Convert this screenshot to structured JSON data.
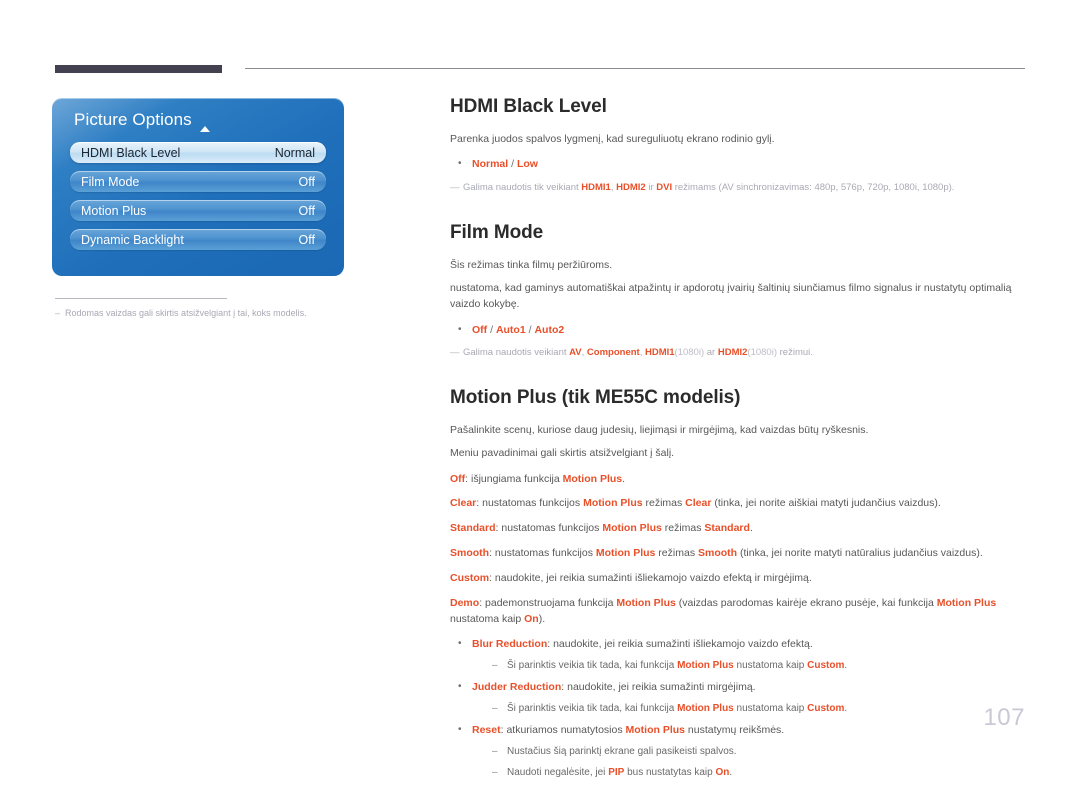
{
  "page_number": "107",
  "osd": {
    "title": "Picture Options",
    "scroll_indicator": "up-arrow",
    "rows": [
      {
        "label": "HDMI Black Level",
        "value": "Normal",
        "selected": true
      },
      {
        "label": "Film Mode",
        "value": "Off",
        "selected": false
      },
      {
        "label": "Motion Plus",
        "value": "Off",
        "selected": false
      },
      {
        "label": "Dynamic Backlight",
        "value": "Off",
        "selected": false
      }
    ],
    "footnote_dash": "‒",
    "footnote": "Rodomas vaizdas gali skirtis atsižvelgiant į tai, koks modelis."
  },
  "sections": {
    "hdmi_black_level": {
      "title": "HDMI Black Level",
      "desc": "Parenka juodos spalvos lygmenį, kad sureguliuotų ekrano rodinio gylį.",
      "bullet": "•",
      "options_pre": "Normal",
      "options_sep": " / ",
      "options_post": "Low",
      "note_dash": "—",
      "note_p1": "Galima naudotis tik veikiant ",
      "note_hl1": "HDMI1",
      "note_p2": ", ",
      "note_hl2": "HDMI2",
      "note_p3": " ir ",
      "note_hl3": "DVI",
      "note_p4": " režimams (AV sinchronizavimas: 480p, 576p, 720p, 1080i, 1080p)."
    },
    "film_mode": {
      "title": "Film Mode",
      "desc1": "Šis režimas tinka filmų peržiūroms.",
      "desc2": "nustatoma, kad gaminys automatiškai atpažintų ir apdorotų įvairių šaltinių siunčiamus filmo signalus ir nustatytų optimalią vaizdo kokybę.",
      "bullet": "•",
      "opt1": "Off",
      "opt_sep1": " / ",
      "opt2": "Auto1",
      "opt_sep2": " / ",
      "opt3": "Auto2",
      "note_dash": "—",
      "note_p1": "Galima naudotis veikiant ",
      "note_hl1": "AV",
      "note_p2": ", ",
      "note_hl2": "Component",
      "note_p3": ", ",
      "note_hl3": "HDMI1",
      "note_dim1": "(1080i)",
      "note_p4": " ar ",
      "note_hl4": "HDMI2",
      "note_dim2": "(1080i)",
      "note_p5": " režimui."
    },
    "motion_plus": {
      "title": "Motion Plus (tik ME55C modelis)",
      "desc1": "Pašalinkite scenų, kuriose daug judesių, liejimąsi ir mirgėjimą, kad vaizdas būtų ryškesnis.",
      "desc2": "Meniu pavadinimai gali skirtis atsižvelgiant į šalį.",
      "items": [
        {
          "term": "Off",
          "t1": ": išjungiama funkcija ",
          "hl1": "Motion Plus",
          "t2": ".",
          "hl2": "",
          "t3": ""
        },
        {
          "term": "Clear",
          "t1": ": nustatomas funkcijos ",
          "hl1": "Motion Plus",
          "t2": " režimas ",
          "hl2": "Clear",
          "t3": " (tinka, jei norite aiškiai matyti judančius vaizdus)."
        },
        {
          "term": "Standard",
          "t1": ": nustatomas funkcijos ",
          "hl1": "Motion Plus",
          "t2": " režimas ",
          "hl2": "Standard",
          "t3": "."
        },
        {
          "term": "Smooth",
          "t1": ": nustatomas funkcijos ",
          "hl1": "Motion Plus",
          "t2": " režimas ",
          "hl2": "Smooth",
          "t3": " (tinka, jei norite matyti natūralius judančius vaizdus)."
        },
        {
          "term": "Custom",
          "t1": ": naudokite, jei reikia sumažinti išliekamojo vaizdo efektą ir mirgėjimą.",
          "hl1": "",
          "t2": "",
          "hl2": "",
          "t3": ""
        },
        {
          "term": "Demo",
          "t1": ": pademonstruojama funkcija ",
          "hl1": "Motion Plus",
          "t2": " (vaizdas parodomas kairėje ekrano pusėje, kai funkcija ",
          "hl2": "Motion Plus",
          "t3": " nustatoma kaip ",
          "hl3": "On",
          "t4": ")."
        }
      ],
      "bullet": "•",
      "subdash": "‒",
      "bullets": [
        {
          "term": "Blur Reduction",
          "text": ": naudokite, jei reikia sumažinti išliekamojo vaizdo efektą.",
          "sub_pre": "Ši parinktis veikia tik tada, kai funkcija ",
          "sub_hl1": "Motion Plus",
          "sub_mid": " nustatoma kaip ",
          "sub_hl2": "Custom",
          "sub_post": "."
        },
        {
          "term": "Judder Reduction",
          "text": ": naudokite, jei reikia sumažinti mirgėjimą.",
          "sub_pre": "Ši parinktis veikia tik tada, kai funkcija ",
          "sub_hl1": "Motion Plus",
          "sub_mid": " nustatoma kaip ",
          "sub_hl2": "Custom",
          "sub_post": "."
        }
      ],
      "reset": {
        "term": "Reset",
        "t1": ": atkuriamos numatytosios ",
        "hl1": "Motion Plus",
        "t2": " nustatymų reikšmės.",
        "sub1": "Nustačius šią parinktį ekrane gali pasikeisti spalvos.",
        "sub2_pre": "Naudoti negalėsite, jei ",
        "sub2_hl": "PIP",
        "sub2_mid": " bus nustatytas kaip ",
        "sub2_hl2": "On",
        "sub2_post": "."
      }
    }
  },
  "colors": {
    "accent_orange": "#e8502a",
    "rule_dark": "#43414f",
    "osd_blue": "#1f6fbb",
    "page_number": "#c9c9d6"
  }
}
